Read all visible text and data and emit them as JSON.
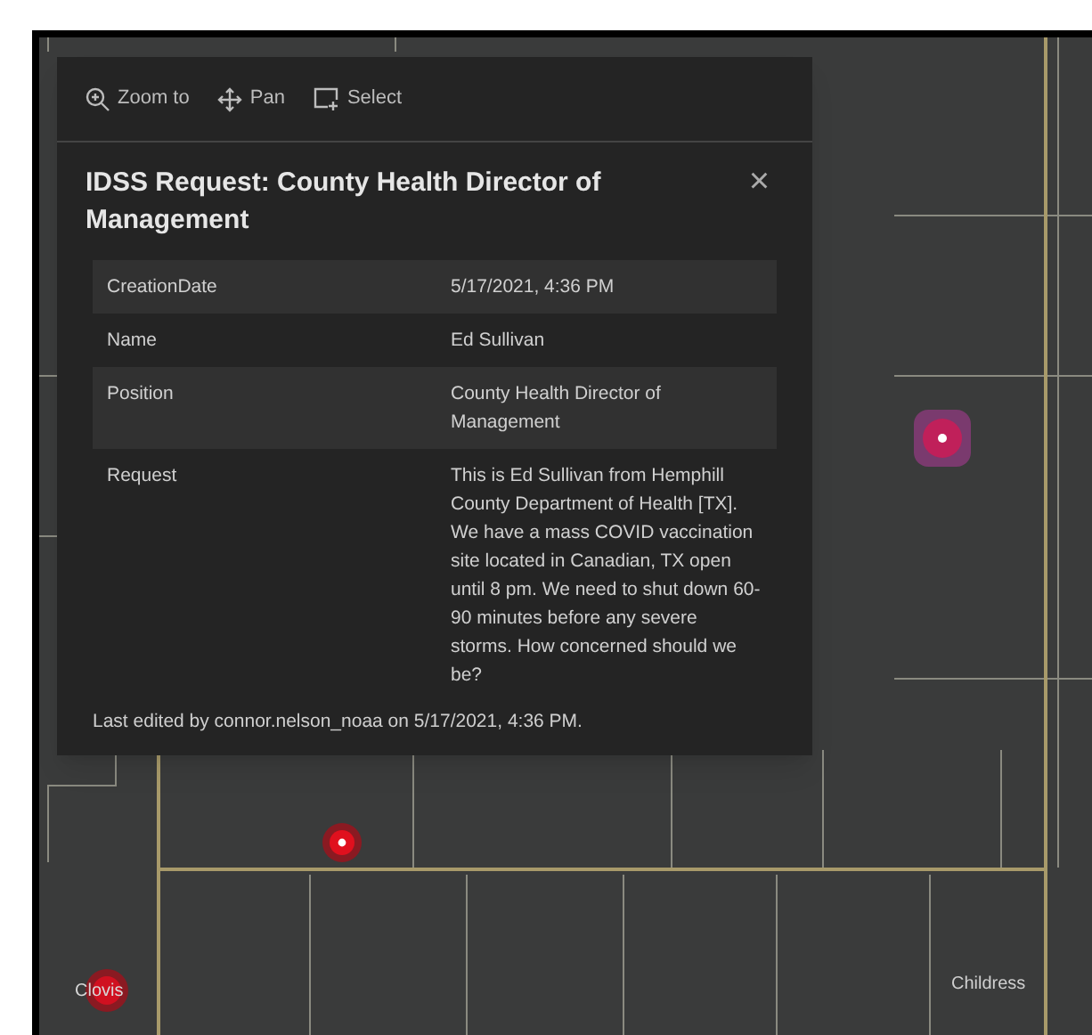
{
  "popup": {
    "actions": [
      {
        "kind": "zoom",
        "label": "Zoom to"
      },
      {
        "kind": "pan",
        "label": "Pan"
      },
      {
        "kind": "select",
        "label": "Select"
      }
    ],
    "title": "IDSS Request: County Health Director of Management",
    "close": "×",
    "fields": [
      {
        "name": "CreationDate",
        "value": "5/17/2021, 4:36 PM"
      },
      {
        "name": "Name",
        "value": "Ed Sullivan"
      },
      {
        "name": "Position",
        "value": "County Health Director of Management"
      },
      {
        "name": "Request",
        "value": "This is Ed Sullivan from Hemphill County Department of Health [TX]. We have a mass COVID vaccination site located in Canadian, TX open until 8 pm. We need to shut down 60-90 minutes before any severe storms. How concerned should we be?"
      }
    ],
    "footer": "Last edited by connor.nelson_noaa on 5/17/2021, 4:36 PM."
  },
  "map": {
    "labels": [
      "Clovis",
      "Childress"
    ]
  }
}
